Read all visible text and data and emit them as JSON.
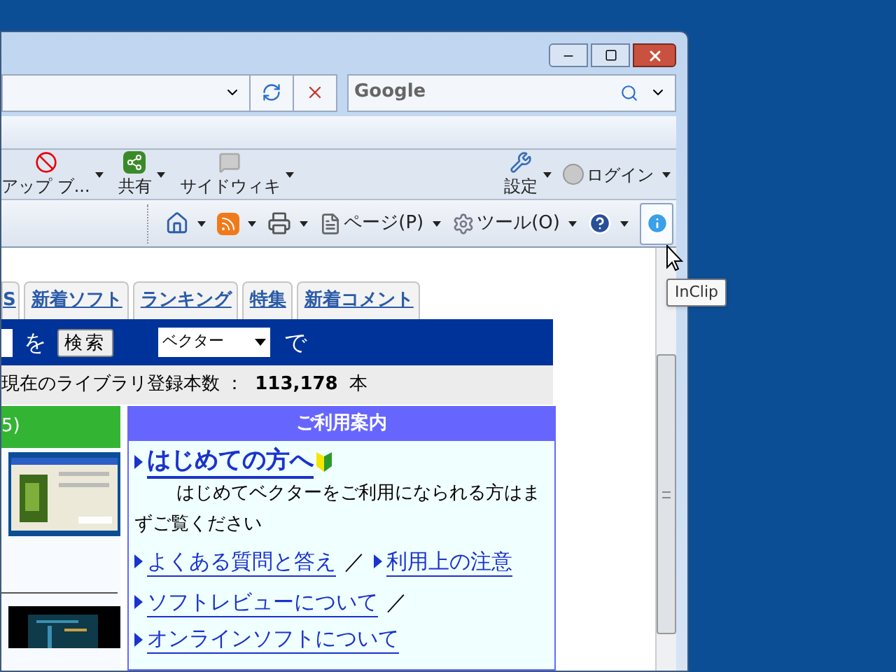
{
  "search": {
    "placeholder": "Google"
  },
  "command_bar": {
    "left": [
      {
        "label": "アップ ブ...",
        "kind": "popup"
      },
      {
        "label": "共有",
        "kind": "share"
      },
      {
        "label": "サイドウィキ",
        "kind": "wiki"
      }
    ],
    "right": [
      {
        "label": "設定",
        "kind": "settings"
      },
      {
        "label": "ログイン",
        "kind": "login"
      }
    ]
  },
  "toolbar": {
    "items": [
      {
        "kind": "home"
      },
      {
        "kind": "feed"
      },
      {
        "kind": "print"
      },
      {
        "kind": "page",
        "label": "ページ(P)"
      },
      {
        "kind": "tools",
        "label": "ツール(O)"
      },
      {
        "kind": "help"
      }
    ],
    "info_button": {
      "hovered": true
    },
    "tooltip": "InClip"
  },
  "tabs": [
    {
      "label": "S"
    },
    {
      "label": "新着ソフト"
    },
    {
      "label": "ランキング"
    },
    {
      "label": "特集"
    },
    {
      "label": "新着コメント"
    }
  ],
  "site_search": {
    "connector": "を",
    "button": "検索",
    "select": "ベクター",
    "suffix": "で"
  },
  "library_count": {
    "label": "現在のライブラリ登録本数 ：",
    "value": "113,178",
    "unit": "本"
  },
  "left_panel": {
    "header": "5)"
  },
  "guide": {
    "title": "ご利用案内",
    "heading": "はじめての方へ",
    "intro": "はじめてベクターをご利用になられる方はまずご覧ください",
    "separator": "／",
    "links": [
      [
        "よくある質問と答え",
        "利用上の注意"
      ],
      [
        "ソフトレビューについて",
        "オンラインソフトについて"
      ]
    ]
  }
}
